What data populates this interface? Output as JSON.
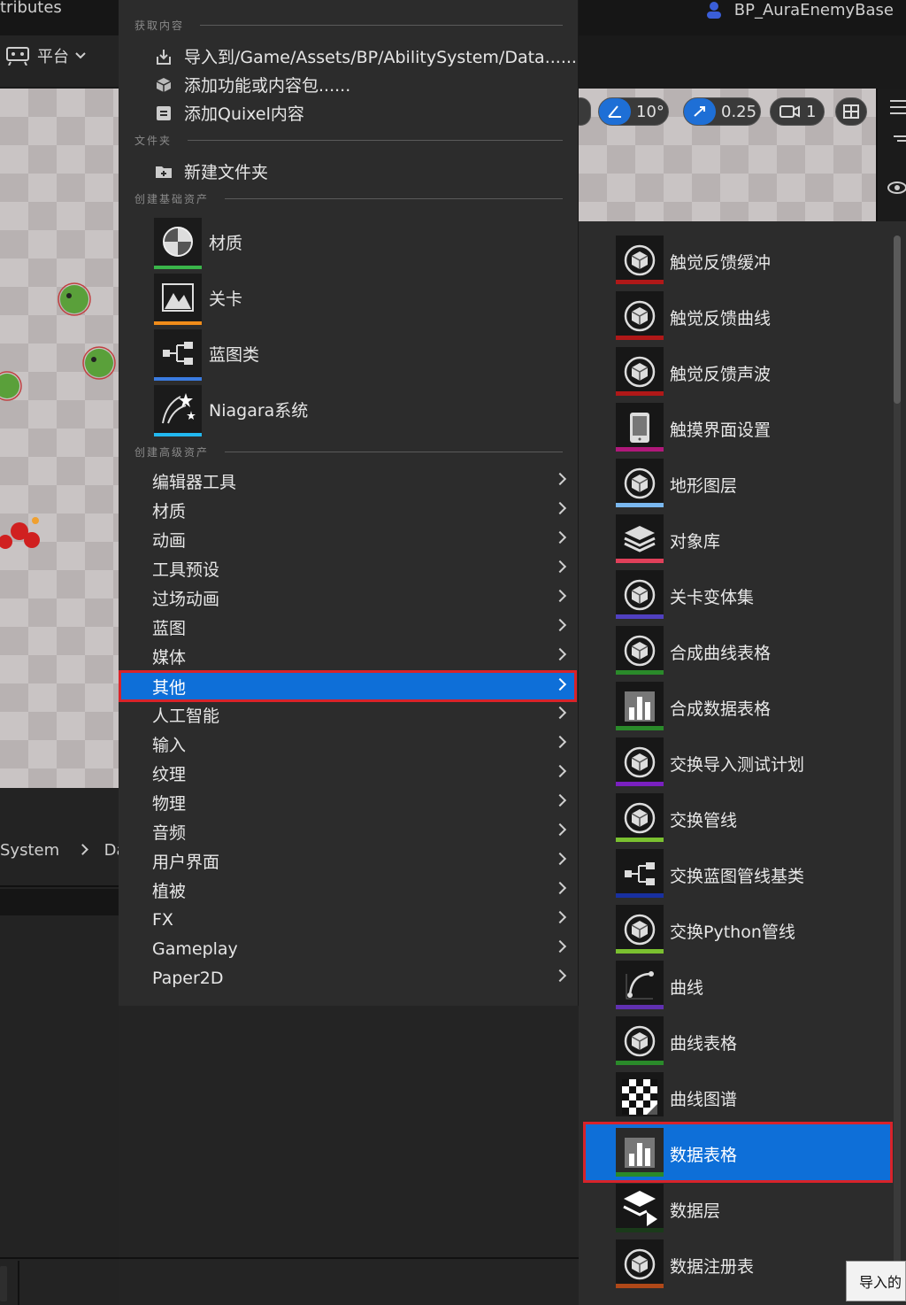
{
  "window": {
    "left_tab": "tributes",
    "right_tab": "BP_AuraEnemyBase"
  },
  "toolbar": {
    "platform_label": "平台",
    "snap_angle": "10°",
    "snap_scale": "0.25",
    "camera_speed": "1"
  },
  "breadcrumb": {
    "item1": "System",
    "item2": "Da"
  },
  "menu": {
    "sections": {
      "get_content": "获取内容",
      "folder": "文件夹",
      "create_basic": "创建基础资产",
      "create_advanced": "创建高级资产"
    },
    "get_content_items": [
      {
        "label": "导入到/Game/Assets/BP/AbilitySystem/Data......",
        "icon": "import-icon"
      },
      {
        "label": "添加功能或内容包......",
        "icon": "feature-pack-icon"
      },
      {
        "label": "添加Quixel内容",
        "icon": "quixel-icon"
      }
    ],
    "folder_items": [
      {
        "label": "新建文件夹",
        "icon": "new-folder-icon"
      }
    ],
    "basic_assets": [
      {
        "label": "材质",
        "icon": "material-icon",
        "color": "#3ab54a"
      },
      {
        "label": "关卡",
        "icon": "level-icon",
        "color": "#f08c1a"
      },
      {
        "label": "蓝图类",
        "icon": "blueprint-class-icon",
        "color": "#3a7be0"
      },
      {
        "label": "Niagara系统",
        "icon": "niagara-icon",
        "color": "#22b8f0"
      }
    ],
    "advanced_assets": [
      "编辑器工具",
      "材质",
      "动画",
      "工具预设",
      "过场动画",
      "蓝图",
      "媒体",
      "其他",
      "人工智能",
      "输入",
      "纹理",
      "物理",
      "音频",
      "用户界面",
      "植被",
      "FX",
      "Gameplay",
      "Paper2D"
    ],
    "selected_advanced": "其他"
  },
  "submenu": {
    "items": [
      {
        "label": "触觉反馈缓冲",
        "icon": "cube-icon",
        "color": "#b01818"
      },
      {
        "label": "触觉反馈曲线",
        "icon": "cube-icon",
        "color": "#b01818"
      },
      {
        "label": "触觉反馈声波",
        "icon": "cube-icon",
        "color": "#b01818"
      },
      {
        "label": "触摸界面设置",
        "icon": "tablet-icon",
        "color": "#b0187a"
      },
      {
        "label": "地形图层",
        "icon": "cube-icon",
        "color": "#7ab8f0"
      },
      {
        "label": "对象库",
        "icon": "layers-icon",
        "color": "#e0405a"
      },
      {
        "label": "关卡变体集",
        "icon": "cube-icon",
        "color": "#5040c0"
      },
      {
        "label": "合成曲线表格",
        "icon": "cube-icon",
        "color": "#2a8a2a"
      },
      {
        "label": "合成数据表格",
        "icon": "data-table-icon",
        "color": "#2a8a2a"
      },
      {
        "label": "交换导入测试计划",
        "icon": "cube-icon",
        "color": "#7a20c0"
      },
      {
        "label": "交换管线",
        "icon": "cube-icon",
        "color": "#7ac030"
      },
      {
        "label": "交换蓝图管线基类",
        "icon": "blueprint-class-icon",
        "color": "#1830a0"
      },
      {
        "label": "交换Python管线",
        "icon": "cube-icon",
        "color": "#7ac030"
      },
      {
        "label": "曲线",
        "icon": "curve-icon",
        "color": "#6030b0"
      },
      {
        "label": "曲线表格",
        "icon": "cube-icon",
        "color": "#2a8a2a"
      },
      {
        "label": "曲线图谱",
        "icon": "checker-icon",
        "color": "#2a2a2a"
      },
      {
        "label": "数据表格",
        "icon": "data-table-icon",
        "color": "#2a8a2a"
      },
      {
        "label": "数据层",
        "icon": "data-layer-icon",
        "color": "#1a3a1a"
      },
      {
        "label": "数据注册表",
        "icon": "cube-icon",
        "color": "#b04818"
      }
    ],
    "selected": "数据表格"
  },
  "tooltip": {
    "text": "导入的"
  }
}
